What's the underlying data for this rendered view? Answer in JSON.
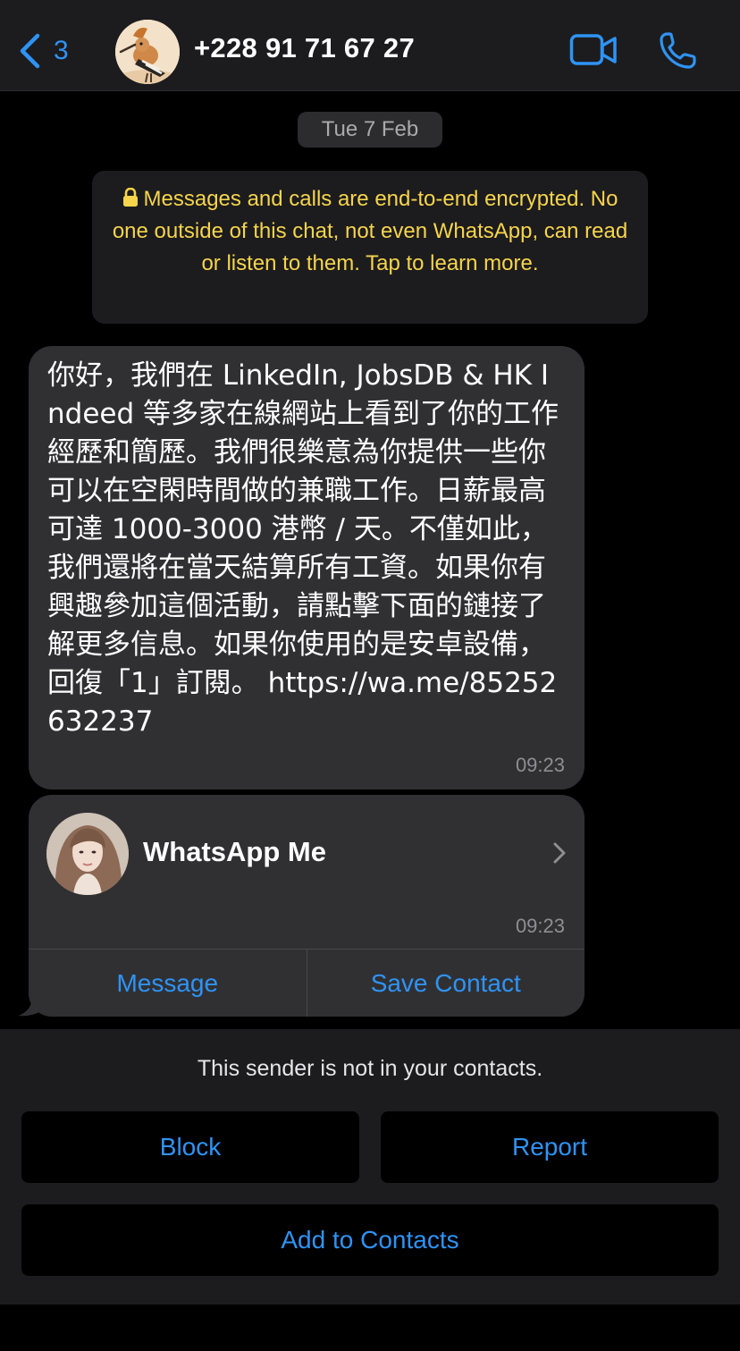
{
  "header": {
    "back_count": "3",
    "contact_number": "+228 91 71 67 27"
  },
  "chat": {
    "date_label": "Tue 7 Feb",
    "encryption_notice": "Messages and calls are end-to-end encrypted. No one outside of this chat, not even WhatsApp, can read or listen to them. Tap to learn more.",
    "message": {
      "text": "你好，我們在 LinkedIn, JobsDB & HK Indeed 等多家在線網站上看到了你的工作經歷和簡歷。我們很樂意為你提供一些你可以在空閑時間做的兼職工作。日薪最高可達 1000-3000 港幣 / 天。不僅如此，我們還將在當天結算所有工資。如果你有興趣參加這個活動，請點擊下面的鏈接了解更多信息。如果你使用的是安卓設備，回復「1」訂閱。",
      "link": "https://wa.me/85252632237",
      "time": "09:23"
    },
    "link_card": {
      "title": "WhatsApp Me",
      "time": "09:23",
      "message_label": "Message",
      "save_contact_label": "Save Contact"
    }
  },
  "sender_panel": {
    "notice": "This sender is not in your contacts.",
    "block_label": "Block",
    "report_label": "Report",
    "add_label": "Add to Contacts"
  },
  "colors": {
    "accent": "#2f93f5",
    "encryption_text": "#f6d44c",
    "bubble": "#303033",
    "header_bg": "#1c1c1e"
  },
  "icons": {
    "back": "chevron-left-icon",
    "video": "video-camera-icon",
    "call": "phone-icon",
    "lock": "lock-icon",
    "card_chevron": "chevron-right-icon"
  }
}
